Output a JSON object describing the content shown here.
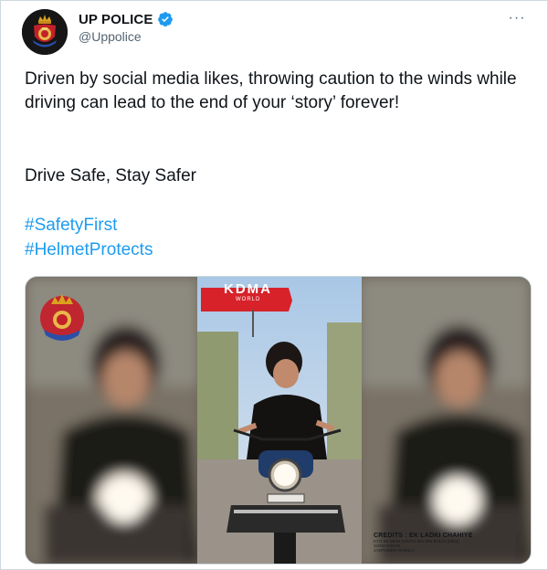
{
  "author": {
    "display_name": "UP POLICE",
    "handle": "@Uppolice",
    "verified": true,
    "avatar_icon": "up-police-emblem-icon"
  },
  "menu": {
    "more_icon": "more-options-icon",
    "more_label": "···"
  },
  "tweet": {
    "text": "Driven by social media likes, throwing caution to the winds while driving can lead to the end of your ‘story’ forever!",
    "slogan": "Drive Safe, Stay Safer",
    "hashtags": [
      "#SafetyFirst",
      "#HelmetProtects"
    ]
  },
  "media": {
    "logo_text": "KDMA",
    "logo_sub": "WORLD",
    "credits_title": "CREDITS : EK LADKI CHAHIYE",
    "credits_lines": [
      "KYO EK MAIN DHUTH MAI BIN BOLTA (2001)",
      "SONU NIGAM",
      "JASPINDER NARULA"
    ]
  },
  "colors": {
    "link": "#1d9bf0",
    "verified_badge": "#1d9bf0",
    "text": "#0f1419",
    "muted": "#536471"
  }
}
